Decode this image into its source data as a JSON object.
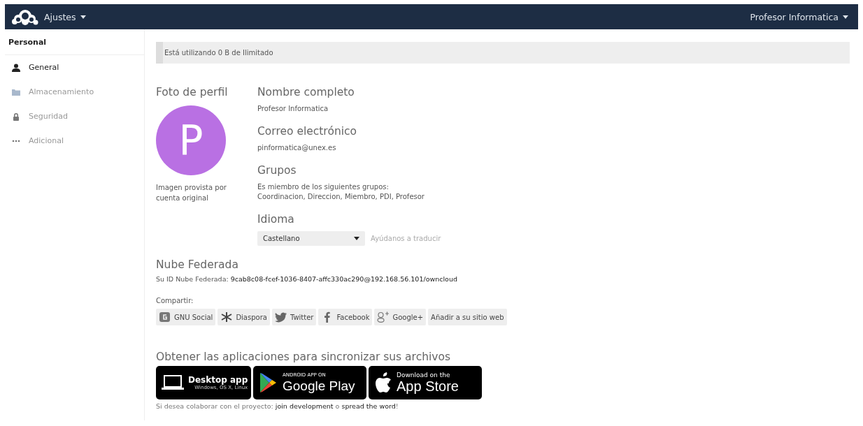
{
  "header": {
    "app_menu": "Ajustes",
    "user_menu": "Profesor Informatica"
  },
  "sidebar": {
    "title": "Personal",
    "items": [
      {
        "label": "General",
        "kind": "user",
        "selected": true
      },
      {
        "label": "Almacenamiento",
        "kind": "folder",
        "selected": false
      },
      {
        "label": "Seguridad",
        "kind": "lock",
        "selected": false
      },
      {
        "label": "Adicional",
        "kind": "dots",
        "selected": false
      }
    ]
  },
  "quota": {
    "text": "Está utilizando 0 B de Ilimitado",
    "level": 0.01
  },
  "profile": {
    "photo_title": "Foto de perfil",
    "avatar_letter": "P",
    "photo_note": "Imagen provista por cuenta original"
  },
  "fields": [
    {
      "title": "Nombre completo",
      "lines": [
        "Profesor Informatica"
      ]
    },
    {
      "title": "Correo electrónico",
      "lines": [
        "pinformatica@unex.es"
      ]
    },
    {
      "title": "Grupos",
      "lines": [
        "Es miembro de los siguientes grupos:",
        "Coordinacion, Direccion, Miembro, PDI, Profesor"
      ]
    }
  ],
  "language": {
    "title": "Idioma",
    "value": "Castellano",
    "help_link": "Ayúdanos a traducir"
  },
  "federated": {
    "title": "Nube Federada",
    "label": "Su ID Nube Federada:",
    "id": "9cab8c08-fcef-1036-8407-affc330ac290@192.168.56.101/owncloud"
  },
  "share": {
    "label": "Compartir:",
    "buttons": [
      {
        "label": "GNU Social",
        "kind": "gnu"
      },
      {
        "label": "Diaspora",
        "kind": "diaspora"
      },
      {
        "label": "Twitter",
        "kind": "twitter"
      },
      {
        "label": "Facebook",
        "kind": "facebook"
      },
      {
        "label": "Google+",
        "kind": "google"
      },
      {
        "label": "Añadir a su sitio web",
        "kind": "plain"
      }
    ]
  },
  "apps": {
    "title": "Obtener las aplicaciones para sincronizar sus archivos",
    "badges": [
      {
        "kind": "desktop",
        "line_1": "Desktop app",
        "line_2": "Windows, OS X, Linux"
      },
      {
        "kind": "android",
        "line_1": "ANDROID APP ON",
        "line_2": "Google Play"
      },
      {
        "kind": "apple",
        "line_1": "Download on the",
        "line_2": "App Store"
      }
    ]
  },
  "footer": {
    "parts": [
      {
        "kind": "text",
        "text": "Si desea colaborar con el proyecto: "
      },
      {
        "kind": "link",
        "text": "join development"
      },
      {
        "kind": "text",
        "text": " o "
      },
      {
        "kind": "link",
        "text": "spread the word"
      },
      {
        "kind": "text",
        "text": "!"
      }
    ]
  }
}
